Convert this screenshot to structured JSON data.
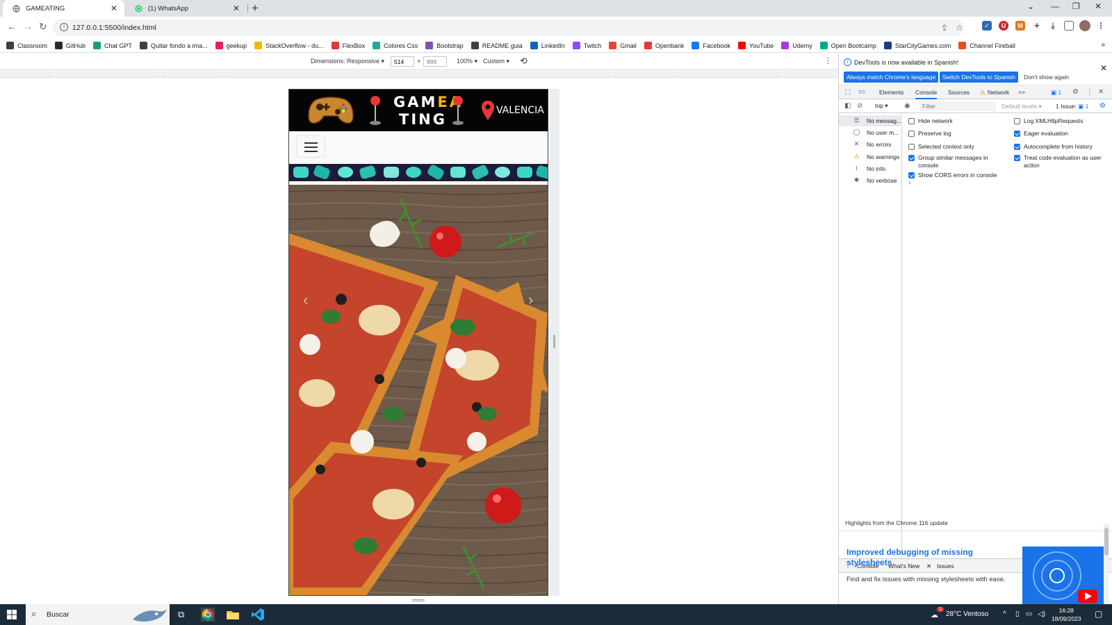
{
  "browser": {
    "tabs": [
      {
        "title": "GAMEATING",
        "active": true
      },
      {
        "title": "(1) WhatsApp",
        "active": false
      }
    ],
    "url": "127.0.0.1:5500/index.html"
  },
  "bookmarks": [
    {
      "label": "Classroom",
      "color": "#3c4043"
    },
    {
      "label": "GitHub",
      "color": "#24292e"
    },
    {
      "label": "Chat GPT",
      "color": "#10a37f"
    },
    {
      "label": "Quitar fondo a ima...",
      "color": "#3c4043"
    },
    {
      "label": "geekup",
      "color": "#e91e63"
    },
    {
      "label": "StackOverflow - du...",
      "color": "#f2b705"
    },
    {
      "label": "FlexBox",
      "color": "#e53935"
    },
    {
      "label": "Colores Css",
      "color": "#26a69a"
    },
    {
      "label": "Bootstrap",
      "color": "#7952b3"
    },
    {
      "label": "README guia",
      "color": "#3c4043"
    },
    {
      "label": "LinkedIn",
      "color": "#0a66c2"
    },
    {
      "label": "Twitch",
      "color": "#9146ff"
    },
    {
      "label": "Gmail",
      "color": "#ea4335"
    },
    {
      "label": "Openbank",
      "color": "#e53935"
    },
    {
      "label": "Facebook",
      "color": "#1877f2"
    },
    {
      "label": "YouTube",
      "color": "#ff0000"
    },
    {
      "label": "Udemy",
      "color": "#a435f0"
    },
    {
      "label": "Open Bootcamp",
      "color": "#00a884"
    },
    {
      "label": "StarCityGames.com",
      "color": "#1d3c78"
    },
    {
      "label": "Channel Fireball",
      "color": "#e8501a"
    }
  ],
  "device_toolbar": {
    "dimensions_label": "Dimensions: Responsive",
    "width": "514",
    "height_placeholder": "999",
    "times": "×",
    "zoom": "100%",
    "throttle": "Custom"
  },
  "site": {
    "brand_line1_a": "GAM",
    "brand_line1_b": "EA",
    "brand_line2_a": "T",
    "brand_line2_b": "ING",
    "city": "VALENCIA"
  },
  "devtools": {
    "notice": "DevTools is now available in Spanish!",
    "btn_match": "Always match Chrome's language",
    "btn_switch": "Switch DevTools to Spanish",
    "link_dont_show": "Don't show again",
    "tabs": [
      "Elements",
      "Console",
      "Sources",
      "Network"
    ],
    "more_tabs": ">>",
    "msg_count": "1",
    "context": "top",
    "filter_placeholder": "Filter",
    "levels": "Default levels",
    "issues": "1 Issue:",
    "issues_count": "1",
    "sidebar": [
      {
        "label": "No messag...",
        "icon": "☰"
      },
      {
        "label": "No user m...",
        "icon": "◯"
      },
      {
        "label": "No errors",
        "icon": "✕"
      },
      {
        "label": "No warnings",
        "icon": "⚠"
      },
      {
        "label": "No info",
        "icon": "i"
      },
      {
        "label": "No verbose",
        "icon": "✱"
      }
    ],
    "options_left": [
      {
        "label": "Hide network",
        "checked": false
      },
      {
        "label": "Preserve log",
        "checked": false
      },
      {
        "label": "Selected context only",
        "checked": false
      },
      {
        "label": "Group similar messages in console",
        "checked": true
      },
      {
        "label": "Show CORS errors in console",
        "checked": true
      }
    ],
    "options_right": [
      {
        "label": "Log XMLHttpRequests",
        "checked": false
      },
      {
        "label": "Eager evaluation",
        "checked": true
      },
      {
        "label": "Autocomplete from history",
        "checked": true
      },
      {
        "label": "Treat code evaluation as user action",
        "checked": true
      }
    ],
    "prompt": "›",
    "drawer_tabs": [
      "Console",
      "What's New",
      "Issues"
    ],
    "whats_new_head": "Highlights from the Chrome 116 update",
    "whats_new_title": "Improved debugging of missing stylesheets",
    "whats_new_desc": "Find and fix issues with missing stylesheets with ease."
  },
  "taskbar": {
    "search": "Buscar",
    "weather": "28°C  Ventoso",
    "time": "16:28",
    "date": "18/09/2023",
    "notif": "1"
  }
}
